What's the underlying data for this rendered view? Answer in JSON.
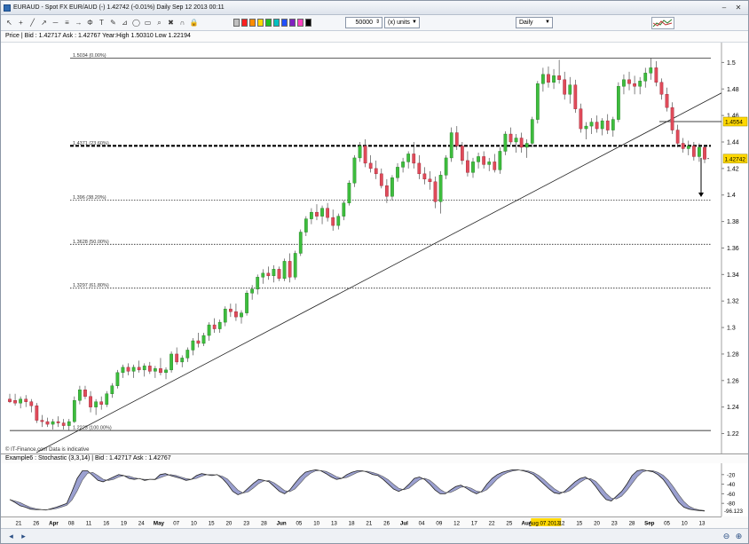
{
  "window": {
    "title": "EURAUD - Spot FX EUR/AUD (-)    1.42742 (-0.01%)    Daily  Sep 12 2013 00:11"
  },
  "toolbar": {
    "tool_icons": [
      "cursor-icon",
      "crosshair-icon",
      "line-icon",
      "ray-icon",
      "hline-icon",
      "channel-icon",
      "arrow-icon",
      "fib-icon",
      "text-icon",
      "pen-icon",
      "gann-icon",
      "ellipse-icon",
      "rectangle-icon",
      "zoom-icon",
      "delete-icon",
      "magnet-icon",
      "lock-icon"
    ],
    "palette_colors": [
      "#c0c0c0",
      "#ff2020",
      "#ff8c00",
      "#ffd800",
      "#20c020",
      "#00c0c0",
      "#2050ff",
      "#8020c0",
      "#ff40c0",
      "#000000"
    ],
    "quantity_value": "50000",
    "units_value": "(x) units",
    "period_value": "Daily"
  },
  "infobar": {
    "text": "Price  |  Bid : 1.42717 Ask : 1.42767 Year:High 1.50310 Low 1.22194"
  },
  "price_axis": {
    "ticks": [
      "1.5",
      "1.48",
      "1.46",
      "1.44",
      "1.42",
      "1.4",
      "1.38",
      "1.36",
      "1.34",
      "1.32",
      "1.3",
      "1.28",
      "1.26",
      "1.24",
      "1.22"
    ],
    "current_label": "1.42742",
    "marker_label": "1.4554",
    "current_color": "#ffd800",
    "marker_color": "#ffd800"
  },
  "fib_levels": [
    {
      "label": "1.5034 (0.00%)"
    },
    {
      "label": "1.4371 (23.60%)"
    },
    {
      "label": "1.396 (38.20%)"
    },
    {
      "label": "1.3628 (50.00%)"
    },
    {
      "label": "1.3297 (61.80%)"
    },
    {
      "label": "1.2223 (100.00%)"
    }
  ],
  "copyright": "© IT-Finance.com  Data is indicative",
  "stochastic": {
    "label": "Example6 : Stochastic (3,3,14)  |  Bid : 1.42717 Ask : 1.42767",
    "ticks": [
      "-20",
      "-40",
      "-60",
      "-80"
    ],
    "current_label": "-96.123"
  },
  "x_axis": {
    "labels": [
      "21",
      "26",
      "Apr",
      "08",
      "11",
      "16",
      "19",
      "24",
      "May",
      "07",
      "10",
      "15",
      "20",
      "23",
      "28",
      "Jun",
      "05",
      "10",
      "13",
      "18",
      "21",
      "26",
      "Jul",
      "04",
      "09",
      "12",
      "17",
      "22",
      "25",
      "Aug",
      "Aug 07 2013",
      "12",
      "15",
      "20",
      "23",
      "28",
      "Sep",
      "05",
      "10",
      "13"
    ],
    "highlight_label": "Aug 07 2013"
  },
  "bottombar": {
    "icons": [
      "scroll-left-icon",
      "scroll-right-icon",
      "zoom-out-icon",
      "zoom-in-icon"
    ]
  },
  "chart_data": {
    "type": "candlestick",
    "title": "EURAUD - Spot FX EUR/AUD (-)",
    "period": "Daily",
    "ylim": [
      1.215,
      1.515
    ],
    "candles": [
      [
        1.246,
        1.25,
        1.243,
        1.244
      ],
      [
        1.245,
        1.25,
        1.241,
        1.243
      ],
      [
        1.243,
        1.248,
        1.239,
        1.246
      ],
      [
        1.246,
        1.249,
        1.24,
        1.244
      ],
      [
        1.244,
        1.246,
        1.236,
        1.241
      ],
      [
        1.241,
        1.243,
        1.228,
        1.23
      ],
      [
        1.23,
        1.234,
        1.225,
        1.229
      ],
      [
        1.229,
        1.232,
        1.225,
        1.227
      ],
      [
        1.227,
        1.231,
        1.223,
        1.229
      ],
      [
        1.229,
        1.233,
        1.225,
        1.228
      ],
      [
        1.228,
        1.231,
        1.223,
        1.226
      ],
      [
        1.226,
        1.231,
        1.222,
        1.229
      ],
      [
        1.229,
        1.248,
        1.228,
        1.245
      ],
      [
        1.245,
        1.256,
        1.242,
        1.253
      ],
      [
        1.253,
        1.256,
        1.246,
        1.248
      ],
      [
        1.248,
        1.252,
        1.236,
        1.24
      ],
      [
        1.24,
        1.246,
        1.234,
        1.244
      ],
      [
        1.244,
        1.248,
        1.238,
        1.242
      ],
      [
        1.242,
        1.252,
        1.24,
        1.25
      ],
      [
        1.25,
        1.258,
        1.247,
        1.256
      ],
      [
        1.256,
        1.268,
        1.254,
        1.266
      ],
      [
        1.266,
        1.272,
        1.262,
        1.27
      ],
      [
        1.27,
        1.273,
        1.264,
        1.267
      ],
      [
        1.267,
        1.272,
        1.262,
        1.27
      ],
      [
        1.27,
        1.275,
        1.266,
        1.268
      ],
      [
        1.268,
        1.273,
        1.263,
        1.271
      ],
      [
        1.271,
        1.274,
        1.265,
        1.267
      ],
      [
        1.267,
        1.271,
        1.262,
        1.269
      ],
      [
        1.269,
        1.277,
        1.264,
        1.266
      ],
      [
        1.266,
        1.27,
        1.261,
        1.268
      ],
      [
        1.268,
        1.282,
        1.266,
        1.28
      ],
      [
        1.28,
        1.285,
        1.272,
        1.274
      ],
      [
        1.274,
        1.279,
        1.27,
        1.277
      ],
      [
        1.277,
        1.285,
        1.274,
        1.283
      ],
      [
        1.283,
        1.292,
        1.279,
        1.29
      ],
      [
        1.29,
        1.296,
        1.285,
        1.288
      ],
      [
        1.288,
        1.296,
        1.286,
        1.294
      ],
      [
        1.294,
        1.304,
        1.29,
        1.302
      ],
      [
        1.302,
        1.307,
        1.296,
        1.299
      ],
      [
        1.299,
        1.306,
        1.296,
        1.304
      ],
      [
        1.304,
        1.316,
        1.301,
        1.314
      ],
      [
        1.314,
        1.318,
        1.308,
        1.312
      ],
      [
        1.312,
        1.318,
        1.305,
        1.308
      ],
      [
        1.308,
        1.313,
        1.303,
        1.311
      ],
      [
        1.311,
        1.328,
        1.309,
        1.326
      ],
      [
        1.326,
        1.332,
        1.321,
        1.329
      ],
      [
        1.329,
        1.34,
        1.325,
        1.338
      ],
      [
        1.338,
        1.344,
        1.333,
        1.341
      ],
      [
        1.341,
        1.346,
        1.336,
        1.339
      ],
      [
        1.339,
        1.347,
        1.334,
        1.344
      ],
      [
        1.344,
        1.346,
        1.335,
        1.337
      ],
      [
        1.337,
        1.352,
        1.335,
        1.35
      ],
      [
        1.35,
        1.356,
        1.334,
        1.338
      ],
      [
        1.338,
        1.358,
        1.336,
        1.356
      ],
      [
        1.356,
        1.374,
        1.354,
        1.372
      ],
      [
        1.372,
        1.384,
        1.369,
        1.382
      ],
      [
        1.382,
        1.39,
        1.378,
        1.387
      ],
      [
        1.387,
        1.393,
        1.381,
        1.384
      ],
      [
        1.384,
        1.392,
        1.378,
        1.39
      ],
      [
        1.39,
        1.394,
        1.38,
        1.383
      ],
      [
        1.383,
        1.389,
        1.373,
        1.377
      ],
      [
        1.377,
        1.386,
        1.374,
        1.384
      ],
      [
        1.384,
        1.396,
        1.381,
        1.394
      ],
      [
        1.394,
        1.411,
        1.392,
        1.409
      ],
      [
        1.409,
        1.43,
        1.406,
        1.428
      ],
      [
        1.428,
        1.44,
        1.425,
        1.437
      ],
      [
        1.437,
        1.442,
        1.421,
        1.424
      ],
      [
        1.424,
        1.43,
        1.417,
        1.42
      ],
      [
        1.42,
        1.426,
        1.412,
        1.416
      ],
      [
        1.416,
        1.42,
        1.405,
        1.407
      ],
      [
        1.407,
        1.412,
        1.394,
        1.399
      ],
      [
        1.399,
        1.415,
        1.396,
        1.413
      ],
      [
        1.413,
        1.424,
        1.41,
        1.421
      ],
      [
        1.421,
        1.428,
        1.417,
        1.425
      ],
      [
        1.425,
        1.433,
        1.42,
        1.431
      ],
      [
        1.431,
        1.44,
        1.42,
        1.424
      ],
      [
        1.424,
        1.43,
        1.412,
        1.416
      ],
      [
        1.416,
        1.421,
        1.408,
        1.412
      ],
      [
        1.412,
        1.418,
        1.404,
        1.41
      ],
      [
        1.41,
        1.414,
        1.39,
        1.395
      ],
      [
        1.395,
        1.418,
        1.386,
        1.415
      ],
      [
        1.415,
        1.43,
        1.412,
        1.428
      ],
      [
        1.428,
        1.451,
        1.425,
        1.447
      ],
      [
        1.447,
        1.452,
        1.434,
        1.437
      ],
      [
        1.437,
        1.44,
        1.423,
        1.426
      ],
      [
        1.426,
        1.433,
        1.414,
        1.417
      ],
      [
        1.417,
        1.428,
        1.413,
        1.425
      ],
      [
        1.425,
        1.432,
        1.42,
        1.429
      ],
      [
        1.429,
        1.433,
        1.42,
        1.423
      ],
      [
        1.423,
        1.428,
        1.418,
        1.425
      ],
      [
        1.425,
        1.431,
        1.417,
        1.419
      ],
      [
        1.419,
        1.436,
        1.416,
        1.433
      ],
      [
        1.433,
        1.448,
        1.43,
        1.446
      ],
      [
        1.446,
        1.451,
        1.438,
        1.44
      ],
      [
        1.44,
        1.446,
        1.432,
        1.443
      ],
      [
        1.443,
        1.447,
        1.432,
        1.436
      ],
      [
        1.436,
        1.442,
        1.428,
        1.439
      ],
      [
        1.439,
        1.459,
        1.436,
        1.457
      ],
      [
        1.457,
        1.486,
        1.454,
        1.484
      ],
      [
        1.484,
        1.496,
        1.478,
        1.491
      ],
      [
        1.491,
        1.497,
        1.481,
        1.485
      ],
      [
        1.485,
        1.495,
        1.48,
        1.49
      ],
      [
        1.49,
        1.502,
        1.484,
        1.487
      ],
      [
        1.487,
        1.493,
        1.472,
        1.476
      ],
      [
        1.476,
        1.489,
        1.469,
        1.483
      ],
      [
        1.483,
        1.487,
        1.462,
        1.465
      ],
      [
        1.465,
        1.469,
        1.447,
        1.45
      ],
      [
        1.45,
        1.455,
        1.442,
        1.452
      ],
      [
        1.452,
        1.458,
        1.446,
        1.455
      ],
      [
        1.455,
        1.46,
        1.447,
        1.45
      ],
      [
        1.45,
        1.458,
        1.445,
        1.456
      ],
      [
        1.456,
        1.461,
        1.446,
        1.449
      ],
      [
        1.449,
        1.459,
        1.444,
        1.457
      ],
      [
        1.457,
        1.485,
        1.455,
        1.482
      ],
      [
        1.482,
        1.491,
        1.476,
        1.487
      ],
      [
        1.487,
        1.493,
        1.479,
        1.484
      ],
      [
        1.484,
        1.49,
        1.476,
        1.482
      ],
      [
        1.482,
        1.489,
        1.476,
        1.486
      ],
      [
        1.486,
        1.496,
        1.481,
        1.492
      ],
      [
        1.492,
        1.503,
        1.487,
        1.496
      ],
      [
        1.496,
        1.501,
        1.482,
        1.485
      ],
      [
        1.485,
        1.488,
        1.472,
        1.476
      ],
      [
        1.476,
        1.481,
        1.463,
        1.466
      ],
      [
        1.466,
        1.47,
        1.446,
        1.449
      ],
      [
        1.449,
        1.453,
        1.436,
        1.439
      ],
      [
        1.439,
        1.443,
        1.432,
        1.435
      ],
      [
        1.435,
        1.441,
        1.43,
        1.437
      ],
      [
        1.437,
        1.44,
        1.426,
        1.429
      ],
      [
        1.429,
        1.439,
        1.425,
        1.436
      ],
      [
        1.436,
        1.438,
        1.424,
        1.427
      ]
    ],
    "horizontal_levels": [
      1.5034,
      1.4371,
      1.396,
      1.3628,
      1.3297,
      1.2223
    ],
    "marker_level": 1.4554,
    "current_price": 1.42742,
    "stochastic_k": [
      -72,
      -78,
      -85,
      -88,
      -92,
      -93,
      -93,
      -94,
      -91,
      -88,
      -84,
      -80,
      -55,
      -28,
      -12,
      -12,
      -22,
      -32,
      -35,
      -30,
      -25,
      -20,
      -22,
      -28,
      -30,
      -28,
      -32,
      -30,
      -30,
      -20,
      -18,
      -22,
      -25,
      -28,
      -32,
      -30,
      -22,
      -18,
      -20,
      -22,
      -20,
      -28,
      -40,
      -55,
      -62,
      -58,
      -48,
      -38,
      -30,
      -32,
      -35,
      -45,
      -55,
      -60,
      -52,
      -38,
      -25,
      -15,
      -12,
      -10,
      -12,
      -18,
      -25,
      -30,
      -28,
      -20,
      -15,
      -12,
      -12,
      -15,
      -20,
      -22,
      -30,
      -40,
      -50,
      -55,
      -50,
      -40,
      -28,
      -25,
      -30,
      -40,
      -52,
      -60,
      -60,
      -52,
      -45,
      -42,
      -48,
      -55,
      -60,
      -55,
      -40,
      -28,
      -20,
      -15,
      -12,
      -10,
      -10,
      -12,
      -15,
      -20,
      -30,
      -40,
      -50,
      -58,
      -60,
      -55,
      -45,
      -35,
      -28,
      -25,
      -32,
      -45,
      -60,
      -72,
      -75,
      -65,
      -55,
      -40,
      -22,
      -12,
      -10,
      -12,
      -14,
      -20,
      -30,
      -45,
      -62,
      -78,
      -88,
      -92,
      -94,
      -95,
      -96
    ]
  }
}
